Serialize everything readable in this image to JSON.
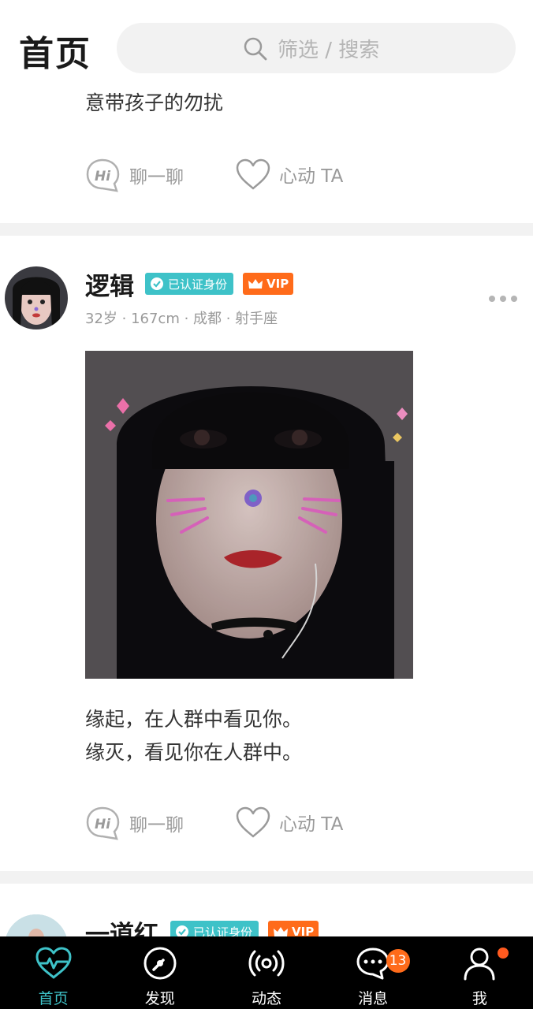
{
  "header": {
    "title": "首页",
    "search_placeholder": "筛选 / 搜索"
  },
  "posts": [
    {
      "text_lines": [
        "意带孩子的勿扰"
      ],
      "actions": {
        "chat": "聊一聊",
        "like": "心动 TA"
      }
    },
    {
      "user": {
        "name": "逻辑",
        "verified": "已认证身份",
        "vip": "VIP",
        "meta": "32岁 · 167cm · 成都 · 射手座"
      },
      "text_lines": [
        "缘起，在人群中看见你。",
        "缘灭，看见你在人群中。"
      ],
      "actions": {
        "chat": "聊一聊",
        "like": "心动 TA"
      }
    },
    {
      "user": {
        "name": "一道红",
        "verified": "已认证身份",
        "vip": "VIP"
      }
    }
  ],
  "tabs": [
    {
      "label": "首页",
      "icon": "heartbeat-icon",
      "active": true
    },
    {
      "label": "发现",
      "icon": "compass-icon"
    },
    {
      "label": "动态",
      "icon": "broadcast-icon"
    },
    {
      "label": "消息",
      "icon": "chat-bubble-icon",
      "badge": "13"
    },
    {
      "label": "我",
      "icon": "profile-icon",
      "dot": true
    }
  ],
  "colors": {
    "accent": "#3ec2c8",
    "vip": "#ff6b1a",
    "tabbar_bg": "#000000",
    "divider": "#f2f2f2",
    "muted_text": "#9a9a9a"
  }
}
